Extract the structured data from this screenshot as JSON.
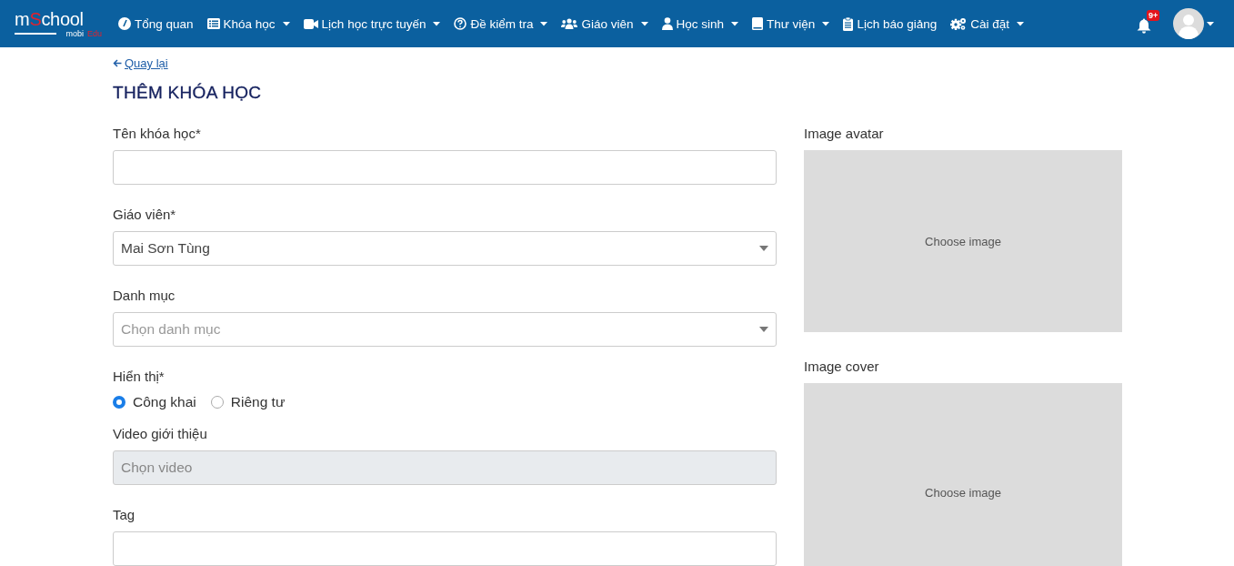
{
  "logo": {
    "prefix": "m",
    "accent": "S",
    "rest": "chool",
    "subtitle_main": "mobi",
    "subtitle_accent": "Edu"
  },
  "nav": [
    {
      "kind": "gauge",
      "label": "Tổng quan",
      "dropdown": false
    },
    {
      "kind": "list",
      "label": "Khóa học",
      "dropdown": true
    },
    {
      "kind": "video",
      "label": "Lịch học trực tuyến",
      "dropdown": true
    },
    {
      "kind": "question",
      "label": "Đề kiểm tra",
      "dropdown": true
    },
    {
      "kind": "users",
      "label": "Giáo viên",
      "dropdown": true
    },
    {
      "kind": "user",
      "label": "Học sinh",
      "dropdown": true
    },
    {
      "kind": "book",
      "label": "Thư viện",
      "dropdown": true
    },
    {
      "kind": "clipboard",
      "label": "Lịch báo giảng",
      "dropdown": false
    },
    {
      "kind": "gears",
      "label": "Cài đặt",
      "dropdown": true
    }
  ],
  "notifications": {
    "badge": "9+"
  },
  "back_link": "Quay lại",
  "page_title": "THÊM KHÓA HỌC",
  "fields": [
    {
      "kind": "text",
      "label": "Tên khóa học*"
    },
    {
      "kind": "select",
      "label": "Giáo viên*",
      "value": "Mai Sơn Tùng"
    },
    {
      "kind": "select",
      "label": "Danh mục",
      "placeholder": "Chọn danh mục"
    },
    {
      "kind": "radio",
      "label": "Hiển thị*",
      "options": [
        {
          "label": "Công khai",
          "selected": true
        },
        {
          "label": "Riêng tư",
          "selected": false
        }
      ]
    },
    {
      "kind": "disabled",
      "label": "Video giới thiệu",
      "placeholder": "Chọn video"
    },
    {
      "kind": "text",
      "label": "Tag"
    }
  ],
  "images": [
    {
      "label": "Image avatar",
      "button": "Choose image"
    },
    {
      "label": "Image cover",
      "button": "Choose image"
    }
  ]
}
